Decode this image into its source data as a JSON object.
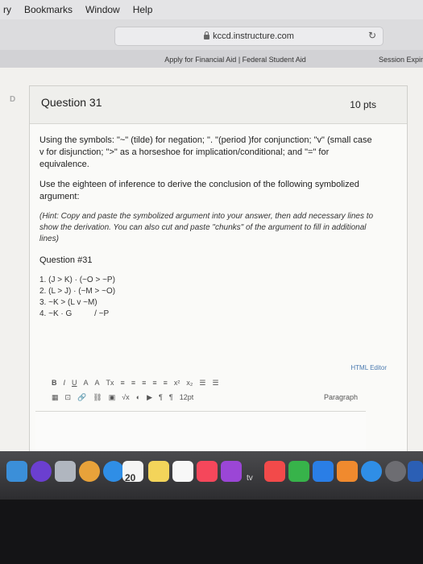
{
  "menubar": {
    "items": [
      "ry",
      "Bookmarks",
      "Window",
      "Help"
    ]
  },
  "browser": {
    "url": "kccd.instructure.com",
    "tab_title": "Apply for Financial Aid | Federal Student Aid",
    "tab_right": "Session Expir"
  },
  "question": {
    "title": "Question 31",
    "points": "10 pts",
    "instructions1": "Using the symbols: \"~\" (tilde) for negation; \". \"(period )for conjunction; \"v\" (small case v for disjunction; \">\" as a horseshoe for implication/conditional; and \"=\" for equivalence.",
    "instructions2": "Use the eighteen of inference to derive the conclusion of the following symbolized argument:",
    "hint": "(Hint: Copy and paste the symbolized argument into your answer, then add necessary lines to show the derivation. You can also cut and paste \"chunks\" of the argument to fill in additional lines)",
    "qnum": "Question #31",
    "lines": [
      "1. (J > K) · (~O > ~P)",
      "2. (L > J) · (~M > ~O)",
      "3. ~K > (L v ~M)",
      "4. ~K · G          / ~P"
    ]
  },
  "editor": {
    "html_editor_label": "HTML Editor",
    "font_size": "12pt",
    "paragraph": "Paragraph",
    "row1": [
      "B",
      "I",
      "U",
      "A",
      "A",
      "Tx",
      "≡",
      "≡",
      "≡",
      "≡",
      "≡",
      "x²",
      "x₂",
      "☰",
      "☰"
    ],
    "row2": [
      "▦",
      "⊡",
      "🔗",
      "⛓",
      "▣",
      "√x",
      "◐",
      "▶",
      "¶",
      "¶",
      "12pt"
    ]
  },
  "dock": {
    "calendar_day": "20",
    "tv_label": "tv"
  }
}
